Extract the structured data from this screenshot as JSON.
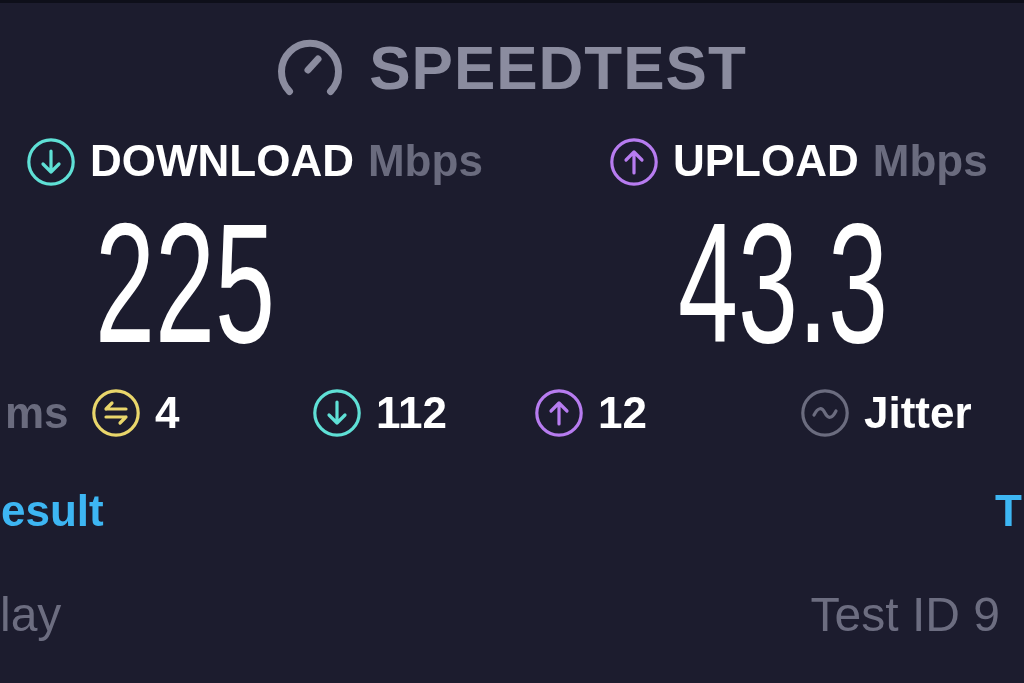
{
  "header": {
    "title": "SPEEDTEST"
  },
  "speeds": [
    {
      "kind": "download",
      "label": "DOWNLOAD",
      "unit": "Mbps",
      "value": "225",
      "color": "#5fe0d6"
    },
    {
      "kind": "upload",
      "label": "UPLOAD",
      "unit": "Mbps",
      "value": "43.3",
      "color": "#b77cf0"
    }
  ],
  "stats": {
    "leading_unit": "ms",
    "items": [
      {
        "kind": "ping",
        "text": "4",
        "color": "#e9d66b"
      },
      {
        "kind": "download",
        "text": "112",
        "color": "#5fe0d6"
      },
      {
        "kind": "upload",
        "text": "12",
        "color": "#b77cf0"
      },
      {
        "kind": "jitter",
        "text": "Jitter",
        "color": "#6b6c7f"
      }
    ]
  },
  "links": [
    "esult",
    "T"
  ],
  "footer": {
    "left_text": "lay",
    "right_text": "Test ID 9"
  }
}
